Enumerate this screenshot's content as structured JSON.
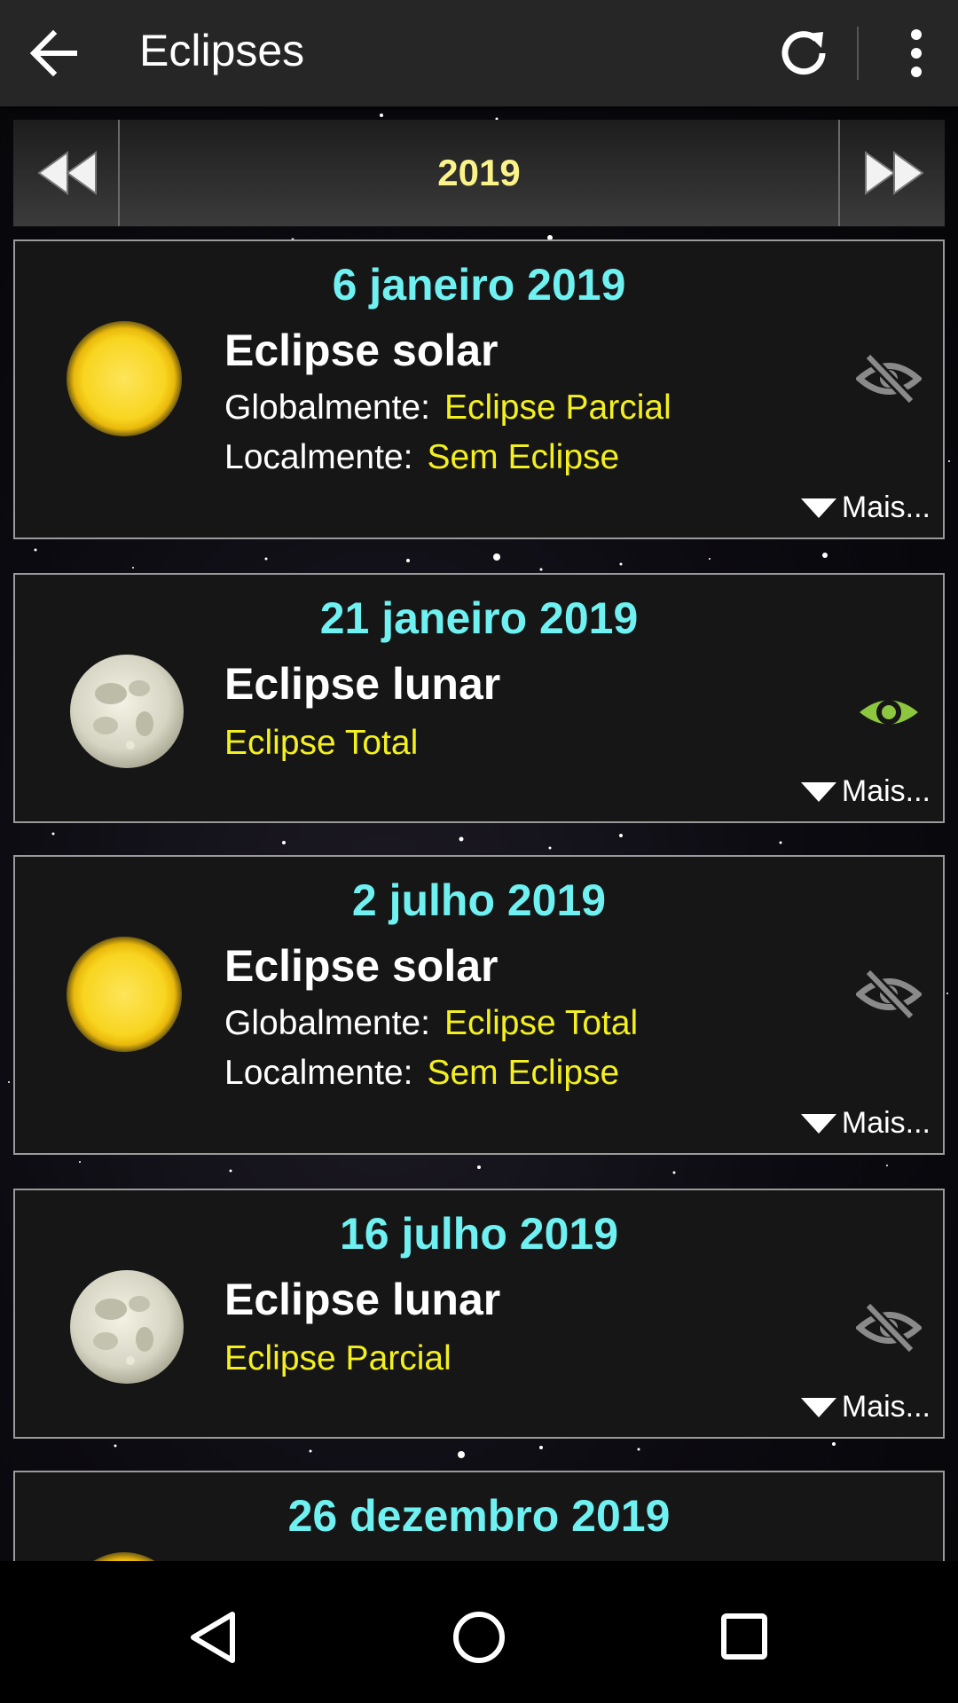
{
  "app": {
    "title": "Eclipses"
  },
  "toolbar": {
    "back_icon": "arrow-left-icon",
    "refresh_icon": "refresh-icon",
    "more_icon": "more-vertical-icon"
  },
  "year_selector": {
    "year": "2019",
    "prev_icon": "fast-rewind-icon",
    "next_icon": "fast-forward-icon"
  },
  "labels": {
    "global": "Globalmente:",
    "local": "Localmente:",
    "more": "Mais..."
  },
  "eclipses": [
    {
      "date": "6 janeiro 2019",
      "title": "Eclipse solar",
      "kind": "solar",
      "global_value": "Eclipse Parcial",
      "local_value": "Sem Eclipse",
      "visible": false
    },
    {
      "date": "21 janeiro 2019",
      "title": "Eclipse lunar",
      "kind": "lunar",
      "subtitle": "Eclipse Total",
      "visible": true
    },
    {
      "date": "2 julho 2019",
      "title": "Eclipse solar",
      "kind": "solar",
      "global_value": "Eclipse Total",
      "local_value": "Sem Eclipse",
      "visible": false
    },
    {
      "date": "16 julho 2019",
      "title": "Eclipse lunar",
      "kind": "lunar",
      "subtitle": "Eclipse Parcial",
      "visible": false
    },
    {
      "date": "26 dezembro 2019",
      "kind": "solar"
    }
  ],
  "colors": {
    "date": "#6ff1f2",
    "value": "#f4f020",
    "year": "#fbf38a",
    "eye_visible": "#8dc63f",
    "eye_hidden": "#8a8a8a"
  },
  "navbar": {
    "back_icon": "nav-back-icon",
    "home_icon": "nav-home-icon",
    "recents_icon": "nav-recents-icon"
  }
}
